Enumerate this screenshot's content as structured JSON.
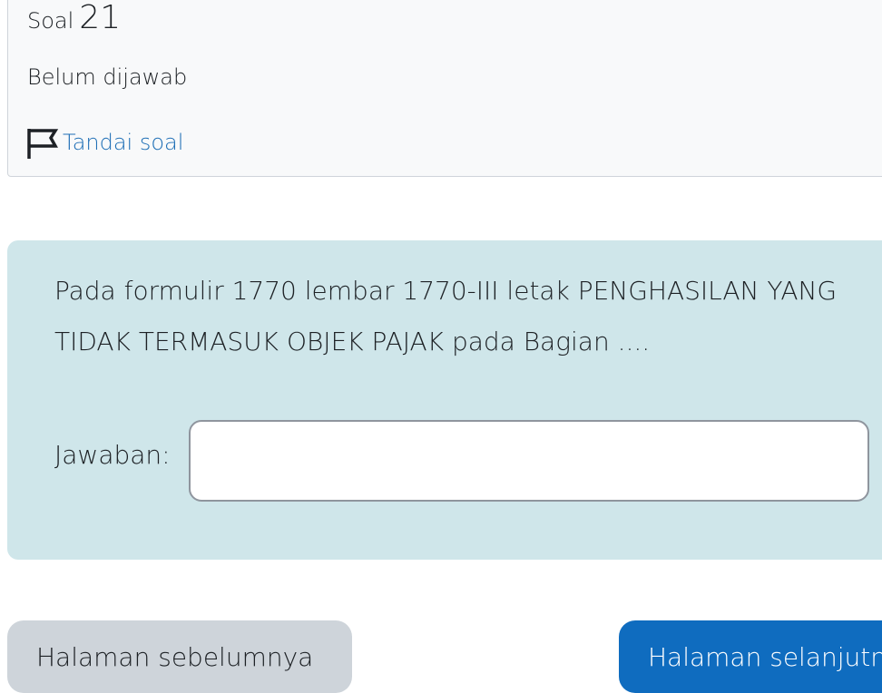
{
  "question_info": {
    "label": "Soal",
    "number": "21",
    "state": "Belum dijawab",
    "flag_label": "Tandai soal",
    "flag_icon": "flag-icon"
  },
  "question": {
    "text": "Pada formulir 1770 lembar 1770-III letak PENGHASILAN YANG TIDAK TERMASUK OBJEK PAJAK pada Bagian ....",
    "answer_label": "Jawaban:",
    "answer_value": ""
  },
  "navigation": {
    "prev_label": "Halaman sebelumnya",
    "next_label": "Halaman selanjutnya"
  },
  "colors": {
    "info_bg": "#f8f9fa",
    "formulation_bg": "#cfe6ea",
    "link": "#1f6fb6",
    "prev_button": "#ced4da",
    "next_button": "#0f6cbf"
  }
}
